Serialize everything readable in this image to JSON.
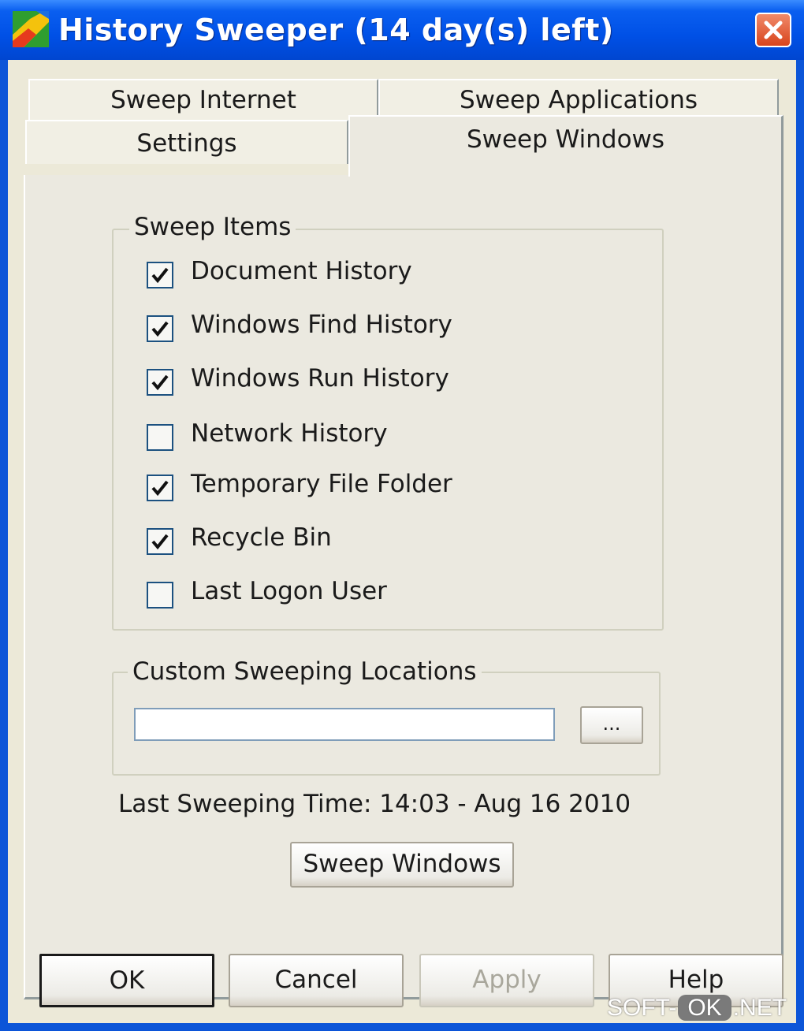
{
  "window": {
    "title": "History Sweeper (14 day(s) left)",
    "icon": "app-icon",
    "close": "close-icon"
  },
  "tabs": {
    "row_top": [
      "Sweep Internet",
      "Sweep Applications"
    ],
    "row_bottom": [
      "Settings",
      "Sweep Windows"
    ],
    "active": "Sweep Windows"
  },
  "sweep_items": {
    "label": "Sweep Items",
    "items": [
      {
        "label": "Document History",
        "checked": true
      },
      {
        "label": "Windows Find History",
        "checked": true
      },
      {
        "label": "Windows Run History",
        "checked": true
      },
      {
        "label": "Network History",
        "checked": false
      },
      {
        "label": "Temporary File Folder",
        "checked": true
      },
      {
        "label": "Recycle Bin",
        "checked": true
      },
      {
        "label": "Last Logon User",
        "checked": false
      }
    ]
  },
  "custom_locations": {
    "label": "Custom Sweeping Locations",
    "value": "",
    "browse_label": "..."
  },
  "last_sweep": "Last Sweeping Time: 14:03 - Aug 16 2010",
  "sweep_button": "Sweep Windows",
  "footer": {
    "ok": "OK",
    "cancel": "Cancel",
    "apply": "Apply",
    "help": "Help"
  },
  "watermark": {
    "left": "SOFT-",
    "mid": "OK",
    "right": ".NET"
  }
}
